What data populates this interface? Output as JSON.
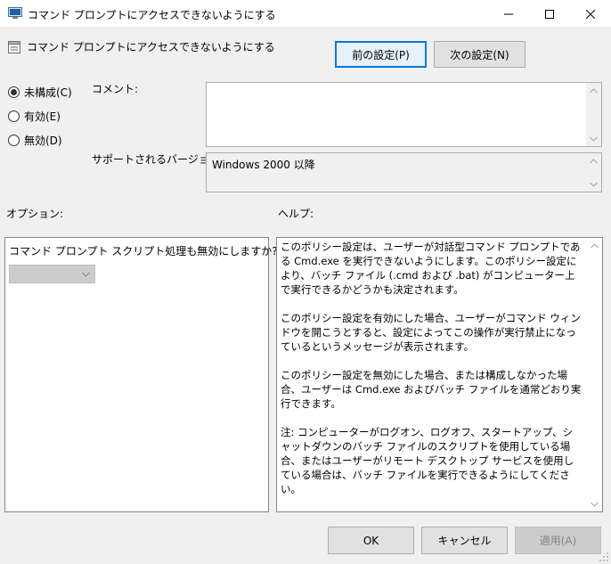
{
  "window": {
    "title": "コマンド プロンプトにアクセスできないようにする",
    "minimize_glyph": "—",
    "maximize_glyph": "☐",
    "close_glyph": "✕"
  },
  "header": {
    "policy_name": "コマンド プロンプトにアクセスできないようにする",
    "prev_button": "前の設定(P)",
    "next_button": "次の設定(N)"
  },
  "state": {
    "options": [
      {
        "label": "未構成(C)",
        "checked": true
      },
      {
        "label": "有効(E)",
        "checked": false
      },
      {
        "label": "無効(D)",
        "checked": false
      }
    ]
  },
  "comment": {
    "label": "コメント:",
    "value": ""
  },
  "supported": {
    "label": "サポートされるバージョン:",
    "value": "Windows 2000 以降"
  },
  "options_section": {
    "label": "オプション:",
    "question": "コマンド プロンプト スクリプト処理も無効にしますか?",
    "combo_value": ""
  },
  "help_section": {
    "label": "ヘルプ:",
    "paragraphs": [
      "このポリシー設定は、ユーザーが対話型コマンド プロンプトである Cmd.exe を実行できないようにします。このポリシー設定により、バッチ ファイル (.cmd および .bat) がコンピューター上で実行できるかどうかも決定されます。",
      "このポリシー設定を有効にした場合、ユーザーがコマンド ウィンドウを開こうとすると、設定によってこの操作が実行禁止になっているというメッセージが表示されます。",
      "このポリシー設定を無効にした場合、または構成しなかった場合、ユーザーは Cmd.exe およびバッチ ファイルを通常どおり実行できます。",
      "注: コンピューターがログオン、ログオフ、スタートアップ、シャットダウンのバッチ ファイルのスクリプトを使用している場合、またはユーザーがリモート デスクトップ サービスを使用している場合は、バッチ ファイルを実行できるようにしてください。"
    ]
  },
  "footer": {
    "ok": "OK",
    "cancel": "キャンセル",
    "apply": "適用(A)"
  },
  "colors": {
    "focus_border": "#0078d7",
    "dialog_bg": "#f0f0f0"
  }
}
